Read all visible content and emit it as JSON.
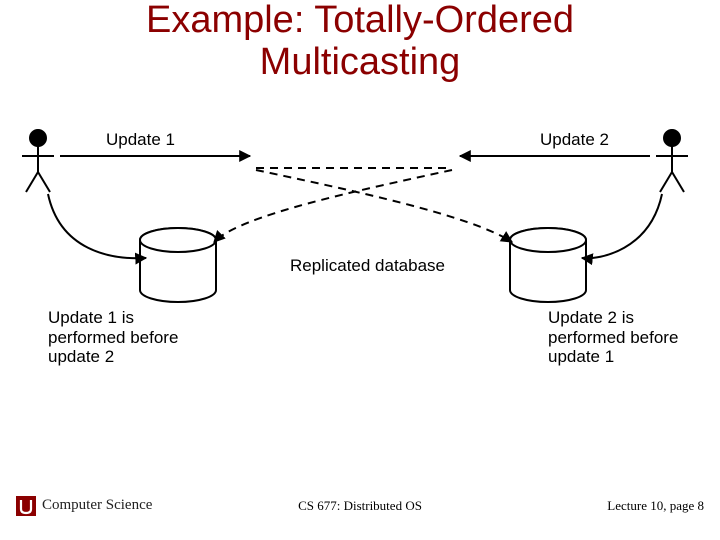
{
  "title_line1": "Example: Totally-Ordered",
  "title_line2": "Multicasting",
  "labels": {
    "update1": "Update 1",
    "update2": "Update 2",
    "replicated_db": "Replicated database",
    "left_caption_l1": "Update 1 is",
    "left_caption_l2": "performed before",
    "left_caption_l3": "update 2",
    "right_caption_l1": "Update 2 is",
    "right_caption_l2": "performed before",
    "right_caption_l3": "update 1"
  },
  "footer": {
    "left": "Computer Science",
    "center": "CS 677: Distributed OS",
    "right": "Lecture 10, page 8"
  },
  "colors": {
    "title": "#8B0000",
    "ink": "#000000"
  }
}
